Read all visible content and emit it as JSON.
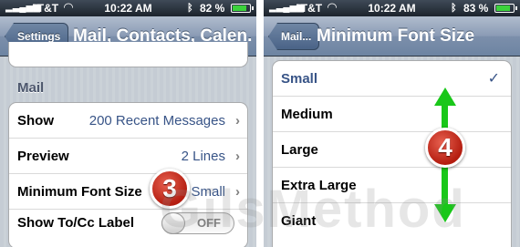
{
  "left": {
    "status": {
      "carrier": "AT&T",
      "time": "10:22 AM",
      "battery": "82 %"
    },
    "nav": {
      "back": "Settings",
      "title": "Mail, Contacts, Calen..."
    },
    "section_header": "Mail",
    "rows": [
      {
        "label": "Show",
        "value": "200 Recent Messages"
      },
      {
        "label": "Preview",
        "value": "2 Lines"
      },
      {
        "label": "Minimum Font Size",
        "value": "Small"
      },
      {
        "label": "Show To/Cc Label",
        "toggle": "OFF"
      }
    ],
    "step_badge": "3"
  },
  "right": {
    "status": {
      "carrier": "AT&T",
      "time": "10:22 AM",
      "battery": "83 %"
    },
    "nav": {
      "back": "Mail...",
      "title": "Minimum Font Size"
    },
    "options": [
      {
        "label": "Small",
        "selected": true
      },
      {
        "label": "Medium"
      },
      {
        "label": "Large"
      },
      {
        "label": "Extra Large"
      },
      {
        "label": "Giant"
      }
    ],
    "check_mark": "✓",
    "step_badge": "4"
  },
  "watermark": "GilsMethod",
  "colors": {
    "accent_blue": "#385487",
    "badge_red": "#c0271a",
    "arrow_green": "#19c719",
    "battery_green": "#3cd23c"
  }
}
